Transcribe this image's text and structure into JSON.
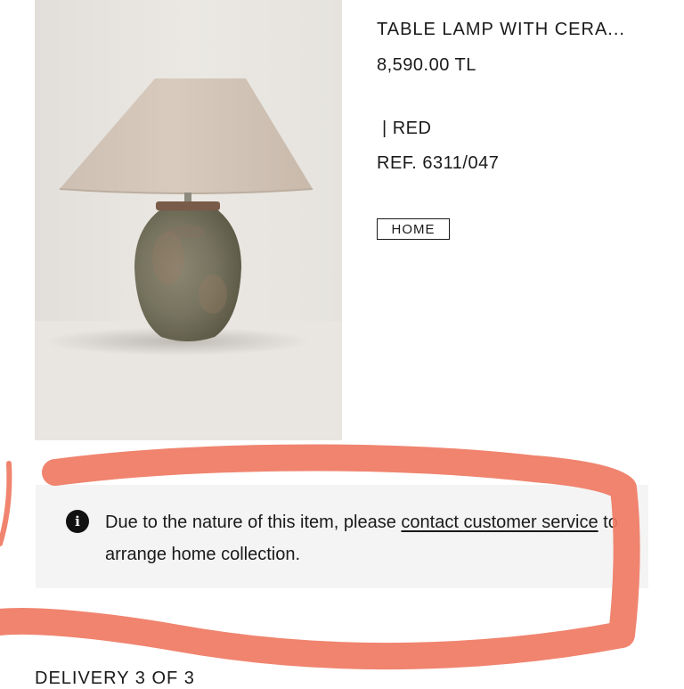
{
  "product": {
    "title": "TABLE LAMP WITH CERA...",
    "price": "8,590.00 TL",
    "color_separator": "|",
    "color": "RED",
    "reference": "REF. 6311/047",
    "category_tag": "HOME",
    "image_alt": "Table lamp with ceramic base"
  },
  "notice": {
    "icon": "info-icon",
    "text_before": "Due to the nature of this item, please ",
    "link_text": "contact customer service",
    "text_after": " to arrange home collection."
  },
  "delivery": {
    "label": "DELIVERY 3 OF 3"
  },
  "colors": {
    "annotation_stroke": "#ef7a63",
    "notice_bg": "#f4f4f4",
    "text": "#1a1a1a"
  }
}
